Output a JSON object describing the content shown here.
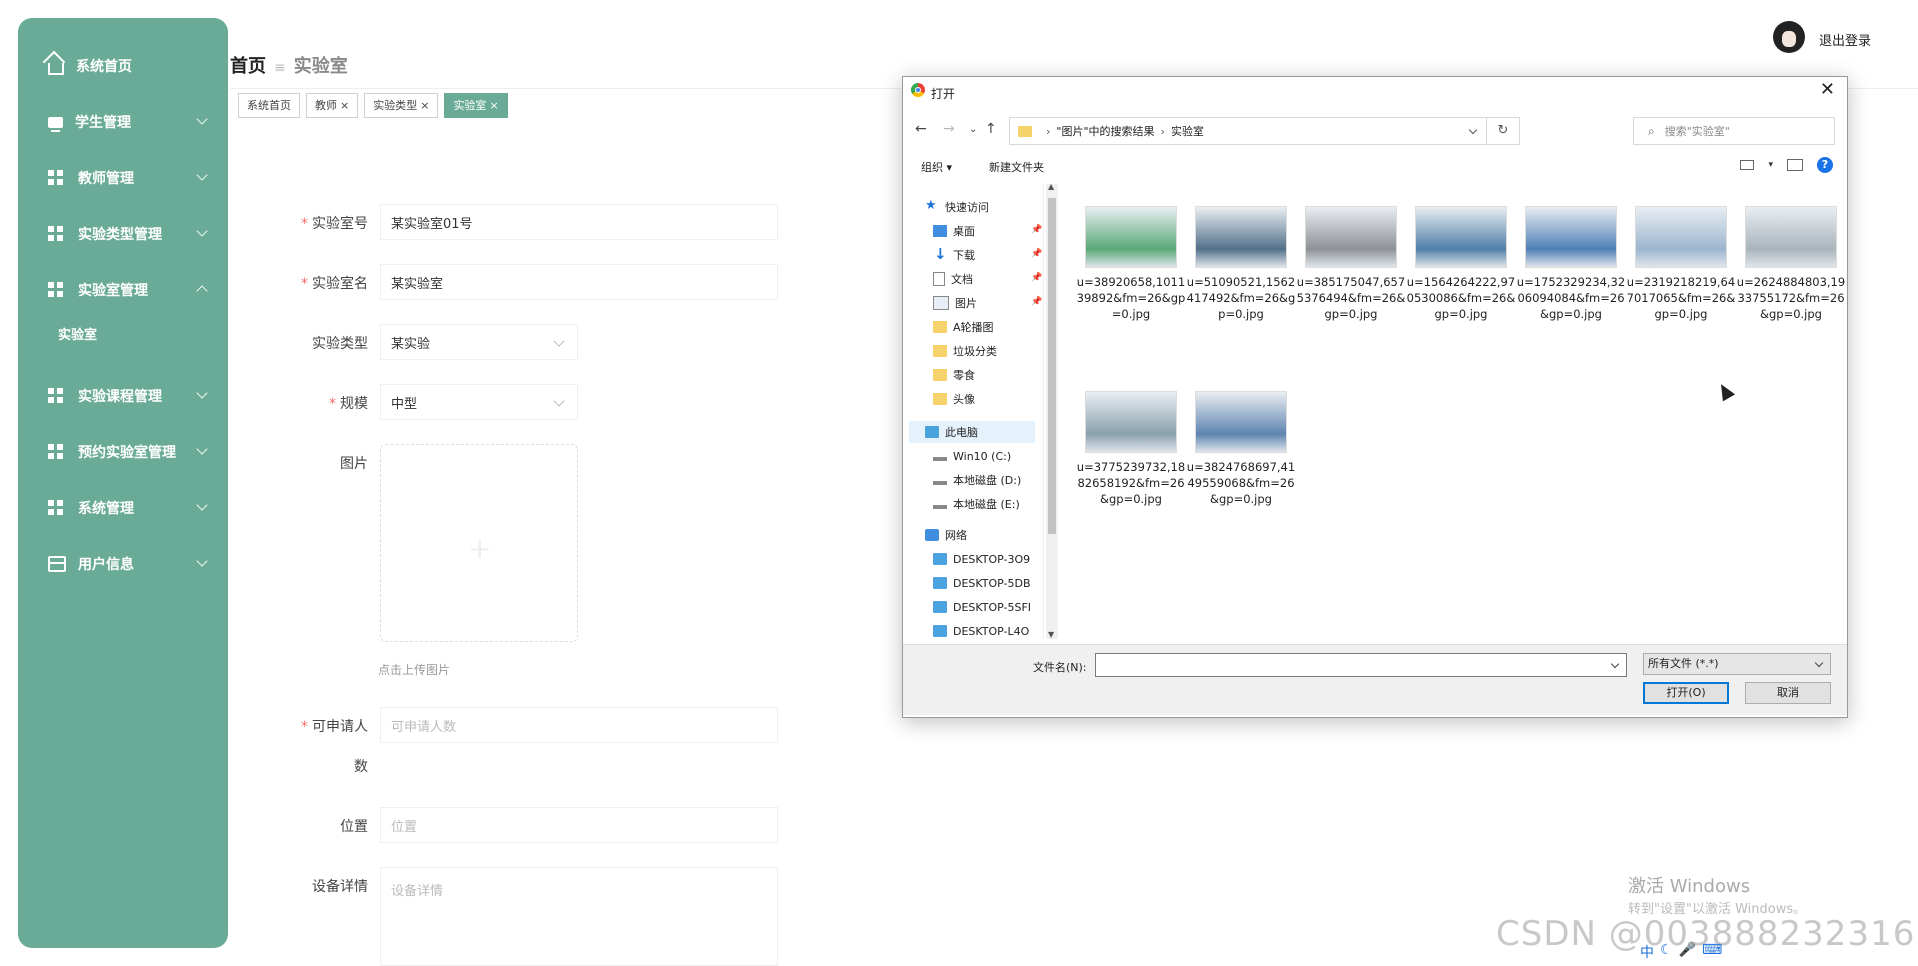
{
  "sidebar": {
    "items": [
      {
        "label": "系统首页"
      },
      {
        "label": "学生管理"
      },
      {
        "label": "教师管理"
      },
      {
        "label": "实验类型管理"
      },
      {
        "label": "实验室管理"
      },
      {
        "label": "实验课程管理"
      },
      {
        "label": "预约实验室管理"
      },
      {
        "label": "系统管理"
      },
      {
        "label": "用户信息"
      }
    ],
    "submenu_active": "实验室"
  },
  "header": {
    "breadcrumb_home": "首页",
    "breadcrumb_current": "实验室",
    "logout": "退出登录"
  },
  "tags": [
    {
      "label": "系统首页",
      "close": ""
    },
    {
      "label": "教师",
      "close": "×"
    },
    {
      "label": "实验类型",
      "close": "×"
    },
    {
      "label": "实验室",
      "close": "×"
    }
  ],
  "form": {
    "lab_no": {
      "label": "实验室号",
      "value": "某实验室01号"
    },
    "lab_name": {
      "label": "实验室名",
      "value": "某实验室"
    },
    "lab_type": {
      "label": "实验类型",
      "value": "某实验"
    },
    "scale": {
      "label": "规模",
      "value": "中型"
    },
    "image": {
      "label": "图片",
      "hint": "点击上传图片"
    },
    "capacity": {
      "label_line1": "可申请人",
      "label_line2": "数",
      "placeholder": "可申请人数"
    },
    "location": {
      "label": "位置",
      "placeholder": "位置"
    },
    "equipment": {
      "label": "设备详情",
      "placeholder": "设备详情"
    }
  },
  "dialog": {
    "title": "打开",
    "close": "✕",
    "address": {
      "part1": "\"图片\"中的搜索结果",
      "part2": "实验室"
    },
    "search_placeholder": "搜索\"实验室\"",
    "toolbar": {
      "organize": "组织 ▾",
      "new_folder": "新建文件夹"
    },
    "help": "?",
    "nav_tree": [
      {
        "label": "快速访问",
        "icon": "star"
      },
      {
        "label": "桌面",
        "icon": "desktop"
      },
      {
        "label": "下载",
        "icon": "download"
      },
      {
        "label": "文档",
        "icon": "doc"
      },
      {
        "label": "图片",
        "icon": "picture"
      },
      {
        "label": "A轮播图",
        "icon": "folder"
      },
      {
        "label": "垃圾分类",
        "icon": "folder"
      },
      {
        "label": "零食",
        "icon": "folder"
      },
      {
        "label": "头像",
        "icon": "folder"
      },
      {
        "label": "此电脑",
        "icon": "pc"
      },
      {
        "label": "Win10 (C:)",
        "icon": "drive"
      },
      {
        "label": "本地磁盘 (D:)",
        "icon": "drive"
      },
      {
        "label": "本地磁盘 (E:)",
        "icon": "drive"
      },
      {
        "label": "网络",
        "icon": "network"
      },
      {
        "label": "DESKTOP-3O9",
        "icon": "pc"
      },
      {
        "label": "DESKTOP-5DB",
        "icon": "pc"
      },
      {
        "label": "DESKTOP-5SFI",
        "icon": "pc"
      },
      {
        "label": "DESKTOP-L4O",
        "icon": "pc"
      }
    ],
    "files": [
      {
        "name": "u=38920658,101139892&fm=26&gp=0.jpg",
        "color": "#59a876"
      },
      {
        "name": "u=51090521,1562417492&fm=26&gp=0.jpg",
        "color": "#52708a"
      },
      {
        "name": "u=385175047,6575376494&fm=26&gp=0.jpg",
        "color": "#8e9296"
      },
      {
        "name": "u=1564264222,970530086&fm=26&gp=0.jpg",
        "color": "#4f7ea8"
      },
      {
        "name": "u=1752329234,3206094084&fm=26&gp=0.jpg",
        "color": "#4f7fb7"
      },
      {
        "name": "u=2319218219,647017065&fm=26&gp=0.jpg",
        "color": "#9cb6cf"
      },
      {
        "name": "u=2624884803,1933755172&fm=26&gp=0.jpg",
        "color": "#a9b4bc"
      },
      {
        "name": "u=3775239732,1882658192&fm=26&gp=0.jpg",
        "color": "#8aa0ae"
      },
      {
        "name": "u=3824768697,4149559068&fm=26&gp=0.jpg",
        "color": "#5e84b0"
      }
    ],
    "filename_label": "文件名(N):",
    "filetype": "所有文件 (*.*)",
    "open": "打开(O)",
    "cancel": "取消"
  },
  "overlay": {
    "watermark_line1": "激活 Windows",
    "watermark_line2": "转到\"设置\"以激活 Windows。",
    "csdn": "CSDN @003888232316",
    "ime": "中"
  },
  "colors": {
    "accent": "#6aab97",
    "required": "#f56c6c",
    "primary_btn_border": "#0078d7"
  }
}
